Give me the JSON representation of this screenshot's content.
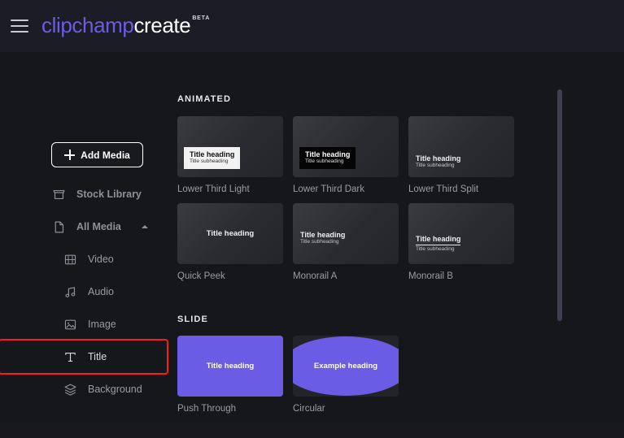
{
  "header": {
    "menu_icon": "hamburger-menu-icon",
    "logo_part1": "clipchamp",
    "logo_part2": "create",
    "badge": "BETA"
  },
  "sidebar": {
    "add_media": {
      "label": "Add Media",
      "icon": "plus-icon"
    },
    "items": [
      {
        "label": "Stock Library",
        "icon": "store-icon",
        "level": "top",
        "highlighted": false
      },
      {
        "label": "All Media",
        "icon": "file-icon",
        "level": "top",
        "highlighted": false,
        "chevron": "chevron-up-icon"
      },
      {
        "label": "Video",
        "icon": "film-icon",
        "level": "sub",
        "highlighted": false
      },
      {
        "label": "Audio",
        "icon": "music-note-icon",
        "level": "sub",
        "highlighted": false
      },
      {
        "label": "Image",
        "icon": "image-icon",
        "level": "sub",
        "highlighted": false
      },
      {
        "label": "Title",
        "icon": "text-t-icon",
        "level": "sub",
        "highlighted": true
      },
      {
        "label": "Background",
        "icon": "layers-icon",
        "level": "sub",
        "highlighted": false
      }
    ]
  },
  "content": {
    "sections": [
      {
        "title": "ANIMATED"
      },
      {
        "title": "SLIDE"
      }
    ],
    "animated": [
      {
        "name": "Lower Third Light",
        "heading": "Title heading",
        "subheading": "Title subheading"
      },
      {
        "name": "Lower Third Dark",
        "heading": "Title heading",
        "subheading": "Title subheading"
      },
      {
        "name": "Lower Third Split",
        "heading": "Title heading",
        "subheading": "Title subheading"
      },
      {
        "name": "Quick Peek",
        "heading": "Title heading",
        "subheading": ""
      },
      {
        "name": "Monorail A",
        "heading": "Title heading",
        "subheading": "Title subheading"
      },
      {
        "name": "Monorail B",
        "heading": "Title heading",
        "subheading": "Title subheading"
      }
    ],
    "slide": [
      {
        "name": "Push Through",
        "heading": "Title heading"
      },
      {
        "name": "Circular",
        "heading": "Example heading"
      }
    ]
  },
  "colors": {
    "brand_purple": "#6b5ce5",
    "header_bg": "#1b1c25",
    "page_bg": "#16171b",
    "highlight_outline": "#ff1a1a",
    "scrollbar_thumb": "#3e3f50"
  }
}
